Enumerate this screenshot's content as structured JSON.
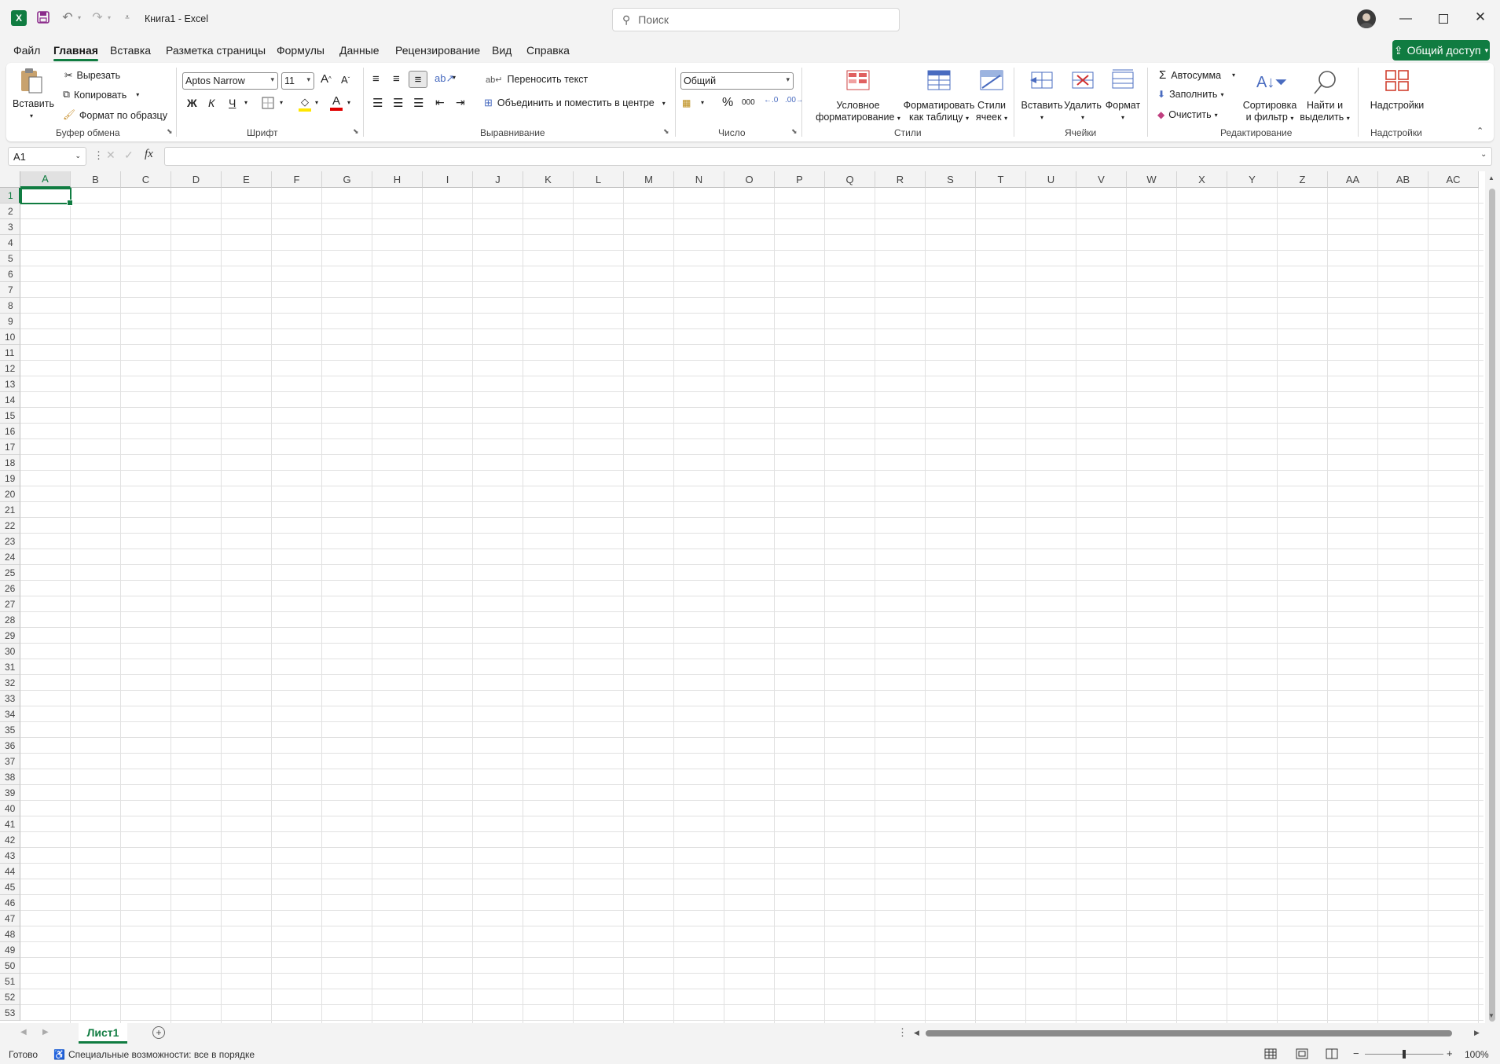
{
  "title_bar": {
    "doc_title": "Книга1 - Excel",
    "search_placeholder": "Поиск",
    "app_icon": "excel-icon",
    "buttons": [
      "save-icon",
      "undo-icon",
      "redo-icon",
      "customize-icon",
      "avatar",
      "minimize-icon",
      "maximize-icon",
      "close-icon"
    ]
  },
  "menu": {
    "tabs": [
      "Файл",
      "Главная",
      "Вставка",
      "Разметка страницы",
      "Формулы",
      "Данные",
      "Рецензирование",
      "Вид",
      "Справка"
    ],
    "active": "Главная",
    "share_label": "Общий доступ"
  },
  "ribbon": {
    "clipboard": {
      "paste": "Вставить",
      "cut": "Вырезать",
      "copy": "Копировать",
      "format_painter": "Формат по образцу",
      "group": "Буфер обмена"
    },
    "font": {
      "name": "Aptos Narrow",
      "size": "11",
      "bold": "Ж",
      "italic": "К",
      "underline": "Ч",
      "group": "Шрифт"
    },
    "alignment": {
      "wrap": "Переносить текст",
      "merge": "Объединить и поместить в центре",
      "group": "Выравнивание"
    },
    "number": {
      "format": "Общий",
      "percent": "%",
      "thousands": "000",
      "group": "Число"
    },
    "styles": {
      "conditional_1": "Условное",
      "conditional_2": "форматирование",
      "table_1": "Форматировать",
      "table_2": "как таблицу",
      "cell_1": "Стили",
      "cell_2": "ячеек",
      "group": "Стили"
    },
    "cells": {
      "insert": "Вставить",
      "delete": "Удалить",
      "format": "Формат",
      "group": "Ячейки"
    },
    "editing": {
      "autosum": "Автосумма",
      "fill": "Заполнить",
      "clear": "Очистить",
      "sort_1": "Сортировка",
      "sort_2": "и фильтр",
      "find_1": "Найти и",
      "find_2": "выделить",
      "group": "Редактирование"
    },
    "addins": {
      "label": "Надстройки",
      "group": "Надстройки"
    }
  },
  "formula_bar": {
    "name_box": "A1",
    "fx_label": "fx",
    "value": ""
  },
  "sheet": {
    "columns": [
      "A",
      "B",
      "C",
      "D",
      "E",
      "F",
      "G",
      "H",
      "I",
      "J",
      "K",
      "L",
      "M",
      "N",
      "O",
      "P",
      "Q",
      "R",
      "S",
      "T",
      "U",
      "V",
      "W",
      "X",
      "Y",
      "Z",
      "AA",
      "AB",
      "AC"
    ],
    "row_count": 53,
    "selected_cell": "A1"
  },
  "sheet_tabs": {
    "active": "Лист1"
  },
  "status": {
    "ready": "Готово",
    "accessibility": "Специальные возможности: все в порядке",
    "zoom": "100%"
  },
  "colors": {
    "accent": "#107c41",
    "ribbon_bg": "#ffffff",
    "chrome_bg": "#f3f3f3"
  }
}
